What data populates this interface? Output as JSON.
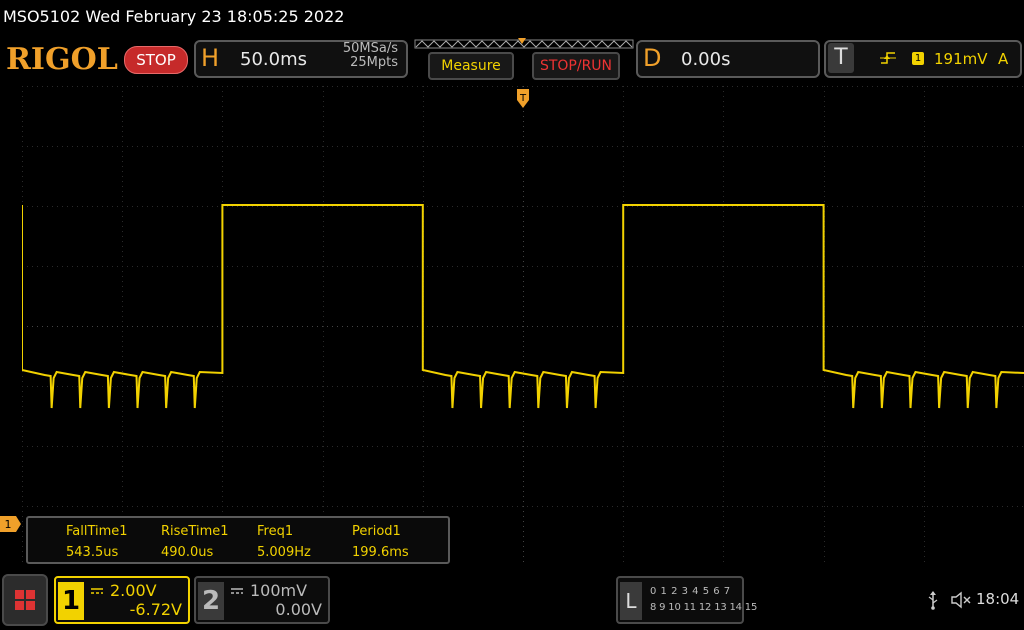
{
  "title_bar": {
    "text": "MSO5102  Wed February 23 18:05:25 2022"
  },
  "toolbar": {
    "logo": "RIGOL",
    "run_state": "STOP",
    "horizontal": {
      "letter": "H",
      "timebase": "50.0ms",
      "sample_rate": "50MSa/s",
      "memory_depth": "25Mpts"
    },
    "measure_label": "Measure",
    "stop_run_label": "STOP/RUN",
    "delay": {
      "letter": "D",
      "value": "0.00s"
    },
    "trigger": {
      "letter": "T",
      "source": "1",
      "level": "191mV",
      "mode": "A",
      "slope_icon": "rising-edge-icon"
    }
  },
  "measurements": [
    {
      "label": "FallTime1",
      "value": "543.5us"
    },
    {
      "label": "RiseTime1",
      "value": "490.0us"
    },
    {
      "label": "Freq1",
      "value": "5.009Hz"
    },
    {
      "label": "Period1",
      "value": "199.6ms"
    }
  ],
  "channel1": {
    "number": "1",
    "scale": "2.00V",
    "offset": "-6.72V",
    "color": "#f2d200"
  },
  "channel2": {
    "number": "2",
    "scale": "100mV",
    "offset": "0.00V",
    "color": "#bbbbbb"
  },
  "la": {
    "letter": "L",
    "row1": "0 1 2 3  4 5 6 7",
    "row2": "8 9 10 11 12 13 14 15"
  },
  "ch1_marker": "1",
  "clock": "18:04",
  "waveform": {
    "type": "square",
    "period_divisions": 4,
    "high_divisions": 2,
    "spikes_per_low": 6,
    "trace_color": "#f2d200",
    "grid_color": "#2a2a2a"
  }
}
